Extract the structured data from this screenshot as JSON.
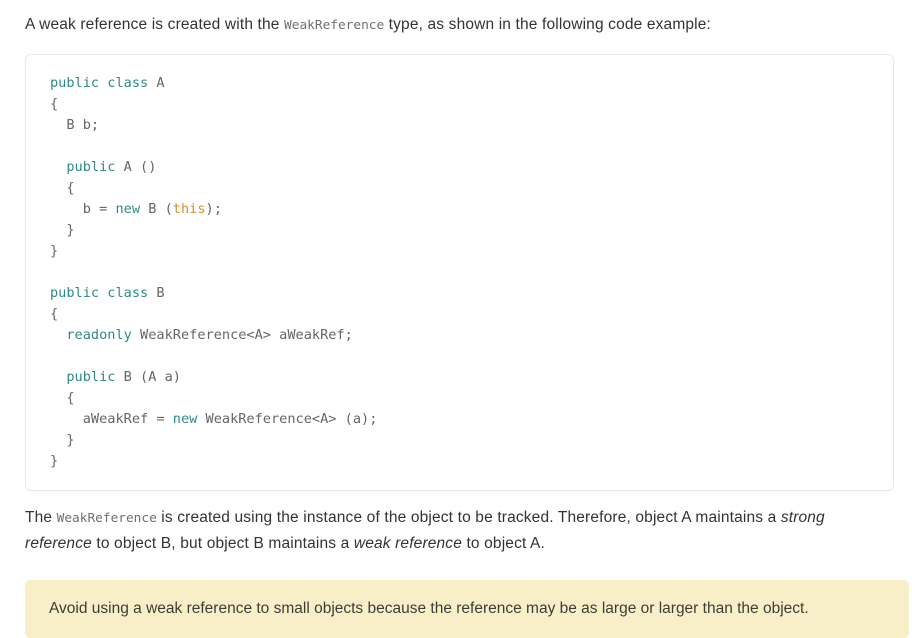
{
  "intro_paragraph": {
    "before_code": "A weak reference is created with the ",
    "inline_code": "WeakReference",
    "after_code": " type, as shown in the following code example:"
  },
  "code_block": {
    "language": "csharp",
    "lines": [
      {
        "segments": [
          {
            "t": "public class",
            "k": "kw"
          },
          {
            "t": " A",
            "k": "plain"
          }
        ]
      },
      {
        "segments": [
          {
            "t": "{",
            "k": "plain"
          }
        ]
      },
      {
        "segments": [
          {
            "t": "  B b;",
            "k": "plain"
          }
        ]
      },
      {
        "segments": [
          {
            "t": "",
            "k": "plain"
          }
        ]
      },
      {
        "segments": [
          {
            "t": "  ",
            "k": "plain"
          },
          {
            "t": "public",
            "k": "kw"
          },
          {
            "t": " A ()",
            "k": "plain"
          }
        ]
      },
      {
        "segments": [
          {
            "t": "  {",
            "k": "plain"
          }
        ]
      },
      {
        "segments": [
          {
            "t": "    b = ",
            "k": "plain"
          },
          {
            "t": "new",
            "k": "kw"
          },
          {
            "t": " B (",
            "k": "plain"
          },
          {
            "t": "this",
            "k": "this"
          },
          {
            "t": ");",
            "k": "plain"
          }
        ]
      },
      {
        "segments": [
          {
            "t": "  }",
            "k": "plain"
          }
        ]
      },
      {
        "segments": [
          {
            "t": "}",
            "k": "plain"
          }
        ]
      },
      {
        "segments": [
          {
            "t": "",
            "k": "plain"
          }
        ]
      },
      {
        "segments": [
          {
            "t": "public class",
            "k": "kw"
          },
          {
            "t": " B",
            "k": "plain"
          }
        ]
      },
      {
        "segments": [
          {
            "t": "{",
            "k": "plain"
          }
        ]
      },
      {
        "segments": [
          {
            "t": "  ",
            "k": "plain"
          },
          {
            "t": "readonly",
            "k": "kw"
          },
          {
            "t": " WeakReference<A> aWeakRef;",
            "k": "plain"
          }
        ]
      },
      {
        "segments": [
          {
            "t": "",
            "k": "plain"
          }
        ]
      },
      {
        "segments": [
          {
            "t": "  ",
            "k": "plain"
          },
          {
            "t": "public",
            "k": "kw"
          },
          {
            "t": " B (A a)",
            "k": "plain"
          }
        ]
      },
      {
        "segments": [
          {
            "t": "  {",
            "k": "plain"
          }
        ]
      },
      {
        "segments": [
          {
            "t": "    aWeakRef = ",
            "k": "plain"
          },
          {
            "t": "new",
            "k": "kw"
          },
          {
            "t": " WeakReference<A> (a);",
            "k": "plain"
          }
        ]
      },
      {
        "segments": [
          {
            "t": "  }",
            "k": "plain"
          }
        ]
      },
      {
        "segments": [
          {
            "t": "}",
            "k": "plain"
          }
        ]
      }
    ]
  },
  "body_paragraph": {
    "seg1": "The ",
    "inline_code": "WeakReference",
    "seg2": " is created using the instance of the object to be tracked. Therefore, object A maintains a ",
    "italic1": "strong reference",
    "seg3": " to object B, but object B maintains a ",
    "italic2": "weak reference",
    "seg4": " to object A."
  },
  "note": {
    "text": "Avoid using a weak reference to small objects because the reference may be as large or larger than the object."
  },
  "colors": {
    "page_background": "#ffffff",
    "body_text": "#333333",
    "inline_code_text": "#6f6f6f",
    "code_plain": "#666666",
    "code_keyword": "#2f8a87",
    "code_this_literal": "#dd8c2c",
    "code_card_border": "#e8e8e8",
    "note_background": "#f8efc9",
    "note_text": "#3d3d33"
  }
}
